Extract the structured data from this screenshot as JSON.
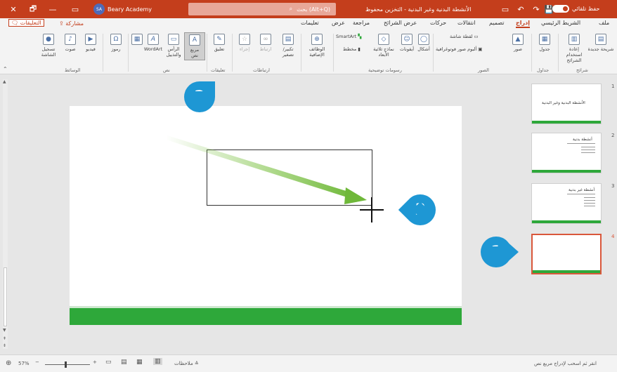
{
  "titlebar": {
    "close_label": "✕",
    "restore_label": "🗗",
    "minimize_label": "—",
    "account_initials": "SA",
    "account_name": "Beary Academy",
    "search_placeholder": "بحث (Alt+Q)",
    "document_title": "الأنشطة البدنية وغير البدنية - التخزين محفوظ",
    "autosave_label": "حفظ تلقائي"
  },
  "tabs": {
    "comments": "التعليقات",
    "share": "مشاركة",
    "items": [
      "ملف",
      "الشريط الرئيسي",
      "إدراج",
      "تصميم",
      "انتقالات",
      "حركات",
      "عرض الشرائح",
      "مراجعة",
      "عرض",
      "تعليمات"
    ],
    "active": "إدراج"
  },
  "ribbon": {
    "groups": [
      "شرائح",
      "جداول",
      "الصور",
      "رسومات توضيحية",
      "ارتباطات",
      "تعليقات",
      "نص",
      "رموز",
      "الوسائط"
    ],
    "buttons": {
      "new_slide": "شريحة جديدة",
      "reuse_slides": "إعادة استخدام الشرائح",
      "table": "جدول",
      "images": "صور",
      "screenshot": "لقطة شاشة",
      "photo_album": "ألبوم صور فوتوغرافية",
      "shapes": "أشكال",
      "icons": "أيقونات",
      "models_3d": "نماذج ثلاثية الأبعاد",
      "smartart": "SmartArt",
      "chart": "مخطط",
      "addins": "الوظائف الإضافية",
      "zoom": "تكبير/تصغير",
      "link": "ارتباط",
      "action": "إجراء",
      "comment": "تعليق",
      "text_box": "مربع نص",
      "header_footer": "الرأس والتذييل",
      "wordart": "WordArt",
      "symbols": "رموز",
      "video": "فيديو",
      "audio": "صوت",
      "screen_recording": "تسجيل الشاشة"
    }
  },
  "slides": {
    "numbers": [
      "1",
      "2",
      "3",
      "4"
    ],
    "slide1_title": "الأنشطة البدنية وغير البدنية",
    "slide2_title": "أنشطة بدنية",
    "slide3_title": "أنشطة غير بدنية",
    "active_index": 4
  },
  "callouts": [
    "1",
    "2",
    "3"
  ],
  "statusbar": {
    "zoom": "57%",
    "notes_label": "ملاحظات",
    "hint": "انقر ثم اسحب لإدراج مربع نص"
  },
  "colors": {
    "accent": "#c43e1c",
    "callout": "#1e97d4",
    "slide_green": "#2ea83a",
    "arrow_green": "#7cc143"
  }
}
